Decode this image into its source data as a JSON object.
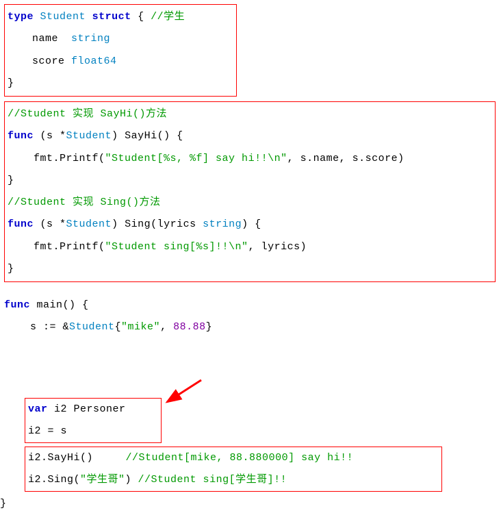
{
  "struct_block": {
    "kw_type": "type",
    "type_name": "Student",
    "kw_struct": "struct",
    "brace_open": "{",
    "comment": "//学生",
    "field1_name": "name",
    "field1_type": "string",
    "field2_name": "score",
    "field2_type": "float64",
    "brace_close": "}"
  },
  "methods_block": {
    "comment1": "//Student 实现 SayHi()方法",
    "kw_func1": "func",
    "recv1_open": "(s *",
    "recv1_type": "Student",
    "recv1_close": ") SayHi() {",
    "body1_prefix": "    fmt.Printf(",
    "body1_str": "\"Student[%s, %f] say hi!!\\n\"",
    "body1_suffix": ", s.name, s.score)",
    "close1": "}",
    "blank": "",
    "comment2": "//Student 实现 Sing()方法",
    "kw_func2": "func",
    "recv2_open": "(s *",
    "recv2_type": "Student",
    "recv2_mid": ") Sing(lyrics ",
    "param_type": "string",
    "recv2_close": ") {",
    "body2_prefix": "    fmt.Printf(",
    "body2_str": "\"Student sing[%s]!!\\n\"",
    "body2_suffix": ", lyrics)",
    "close2": "}"
  },
  "main_block": {
    "kw_func": "func",
    "main_sig": " main() {",
    "assign_prefix": "    s := &",
    "assign_type": "Student",
    "assign_brace": "{",
    "assign_str": "\"mike\"",
    "assign_sep": ", ",
    "assign_num": "88.88",
    "assign_close": "}",
    "var_kw": "var",
    "var_rest": " i2 Personer",
    "i2_assign": "i2 = s",
    "call1_code": "i2.SayHi()",
    "call1_pad": "     ",
    "call1_comment": "//Student[mike, 88.880000] say hi!!",
    "call2_prefix": "i2.Sing(",
    "call2_str": "\"学生哥\"",
    "call2_suffix": ") ",
    "call2_comment": "//Student sing[学生哥]!!",
    "close": "}"
  }
}
